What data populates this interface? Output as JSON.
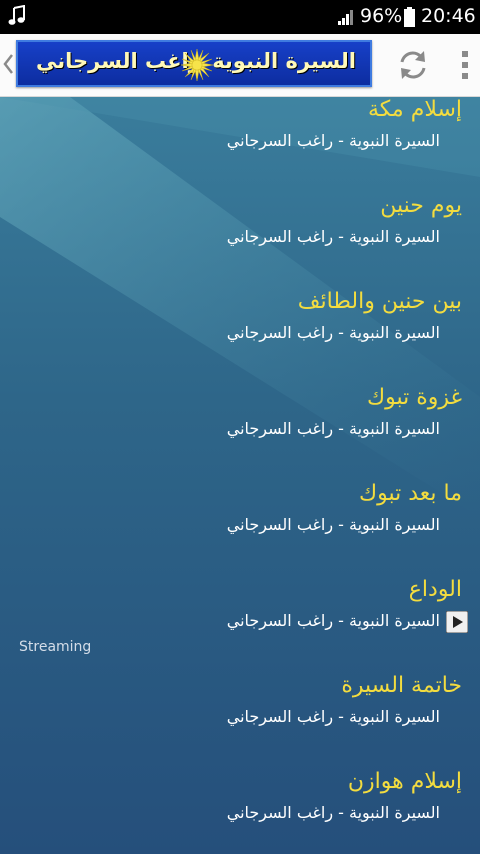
{
  "status_bar": {
    "battery_percent": "96%",
    "time": "20:46",
    "icons": [
      "music-note-icon",
      "signal-icon",
      "battery-icon"
    ]
  },
  "header": {
    "banner_title": "السيرة النبوية",
    "banner_author": "راغب السرجاني",
    "icons": [
      "back-chevron-icon",
      "sun-icon",
      "refresh-icon",
      "overflow-menu-icon"
    ]
  },
  "colors": {
    "title_yellow": "#f3dc3f",
    "banner_blue": "#1740c8",
    "content_bg": "#2e6689"
  },
  "streaming_label": "Streaming",
  "lectures": [
    {
      "title": "إسلام مكة",
      "subtitle": "السيرة النبوية - راغب السرجاني"
    },
    {
      "title": "يوم حنين",
      "subtitle": "السيرة النبوية - راغب السرجاني"
    },
    {
      "title": "بين حنين والطائف",
      "subtitle": "السيرة النبوية - راغب السرجاني"
    },
    {
      "title": "غزوة تبوك",
      "subtitle": "السيرة النبوية - راغب السرجاني"
    },
    {
      "title": "ما بعد تبوك",
      "subtitle": "السيرة النبوية - راغب السرجاني"
    },
    {
      "title": "الوداع",
      "subtitle": "السيرة النبوية - راغب السرجاني",
      "playing": true
    },
    {
      "title": "خاتمة السيرة",
      "subtitle": "السيرة النبوية - راغب السرجاني"
    },
    {
      "title": "إسلام هوازن",
      "subtitle": "السيرة النبوية - راغب السرجاني"
    }
  ]
}
